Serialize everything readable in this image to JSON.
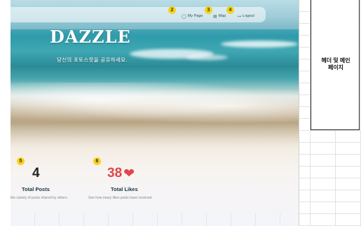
{
  "nav": {
    "links": [
      {
        "badge": "2",
        "icon": "user-icon",
        "label": "My Page"
      },
      {
        "badge": "3",
        "icon": "map-icon",
        "label": "Map"
      },
      {
        "badge": "4",
        "icon": "logout-icon",
        "label": "Logout"
      }
    ]
  },
  "hero": {
    "brand": "DAZZLE",
    "tagline": "당신의 포토스팟을 공유하세요."
  },
  "stats": [
    {
      "badge": "5",
      "value": "4",
      "title": "Total Posts",
      "desc": "the variety of posts shared by others."
    },
    {
      "badge": "6",
      "value": "38",
      "title": "Total Likes",
      "desc": "See how many likes posts have received."
    }
  ],
  "sheet": {
    "label_line1": "헤더 및 메인",
    "label_line2": "페이지"
  },
  "colors": {
    "badge": "#f4d21c",
    "likes": "#e2454a",
    "stat_title": "#1e3345"
  }
}
